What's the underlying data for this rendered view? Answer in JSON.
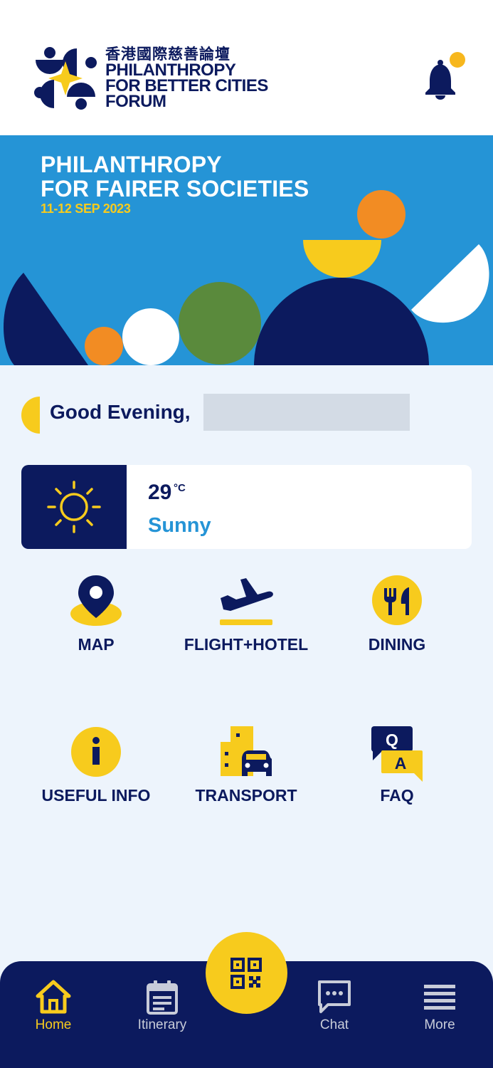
{
  "header": {
    "logo": {
      "name_zh": "香港國際慈善論壇",
      "name_en_lines": [
        "PHILANTHROPY",
        "FOR BETTER CITIES",
        "FORUM"
      ]
    },
    "notification_icon": "bell-icon"
  },
  "banner": {
    "title_lines": [
      "PHILANTHROPY",
      "FOR FAIRER SOCIETIES"
    ],
    "date": "11-12 SEP 2023"
  },
  "greeting": {
    "text": "Good Evening,",
    "icon": "moon-icon"
  },
  "weather": {
    "temperature": "29",
    "unit": "°C",
    "condition": "Sunny",
    "icon": "sun-icon"
  },
  "grid": [
    {
      "label": "MAP",
      "icon": "map-pin-icon"
    },
    {
      "label": "FLIGHT+HOTEL",
      "icon": "airplane-icon"
    },
    {
      "label": "DINING",
      "icon": "utensils-icon"
    },
    {
      "label": "USEFUL INFO",
      "icon": "info-icon"
    },
    {
      "label": "TRANSPORT",
      "icon": "car-building-icon"
    },
    {
      "label": "FAQ",
      "icon": "qa-icon"
    }
  ],
  "nav": {
    "items": [
      {
        "label": "Home",
        "icon": "home-icon",
        "active": true
      },
      {
        "label": "Itinerary",
        "icon": "calendar-icon",
        "active": false
      },
      {
        "label": "Chat",
        "icon": "chat-icon",
        "active": false
      },
      {
        "label": "More",
        "icon": "menu-icon",
        "active": false
      }
    ],
    "center_button_icon": "qr-code-icon"
  },
  "colors": {
    "navy": "#0c1a5e",
    "blue": "#2594d6",
    "yellow": "#f7cb1d",
    "orange": "#f28c23",
    "green": "#5a8a3c",
    "background": "#edf4fc"
  }
}
